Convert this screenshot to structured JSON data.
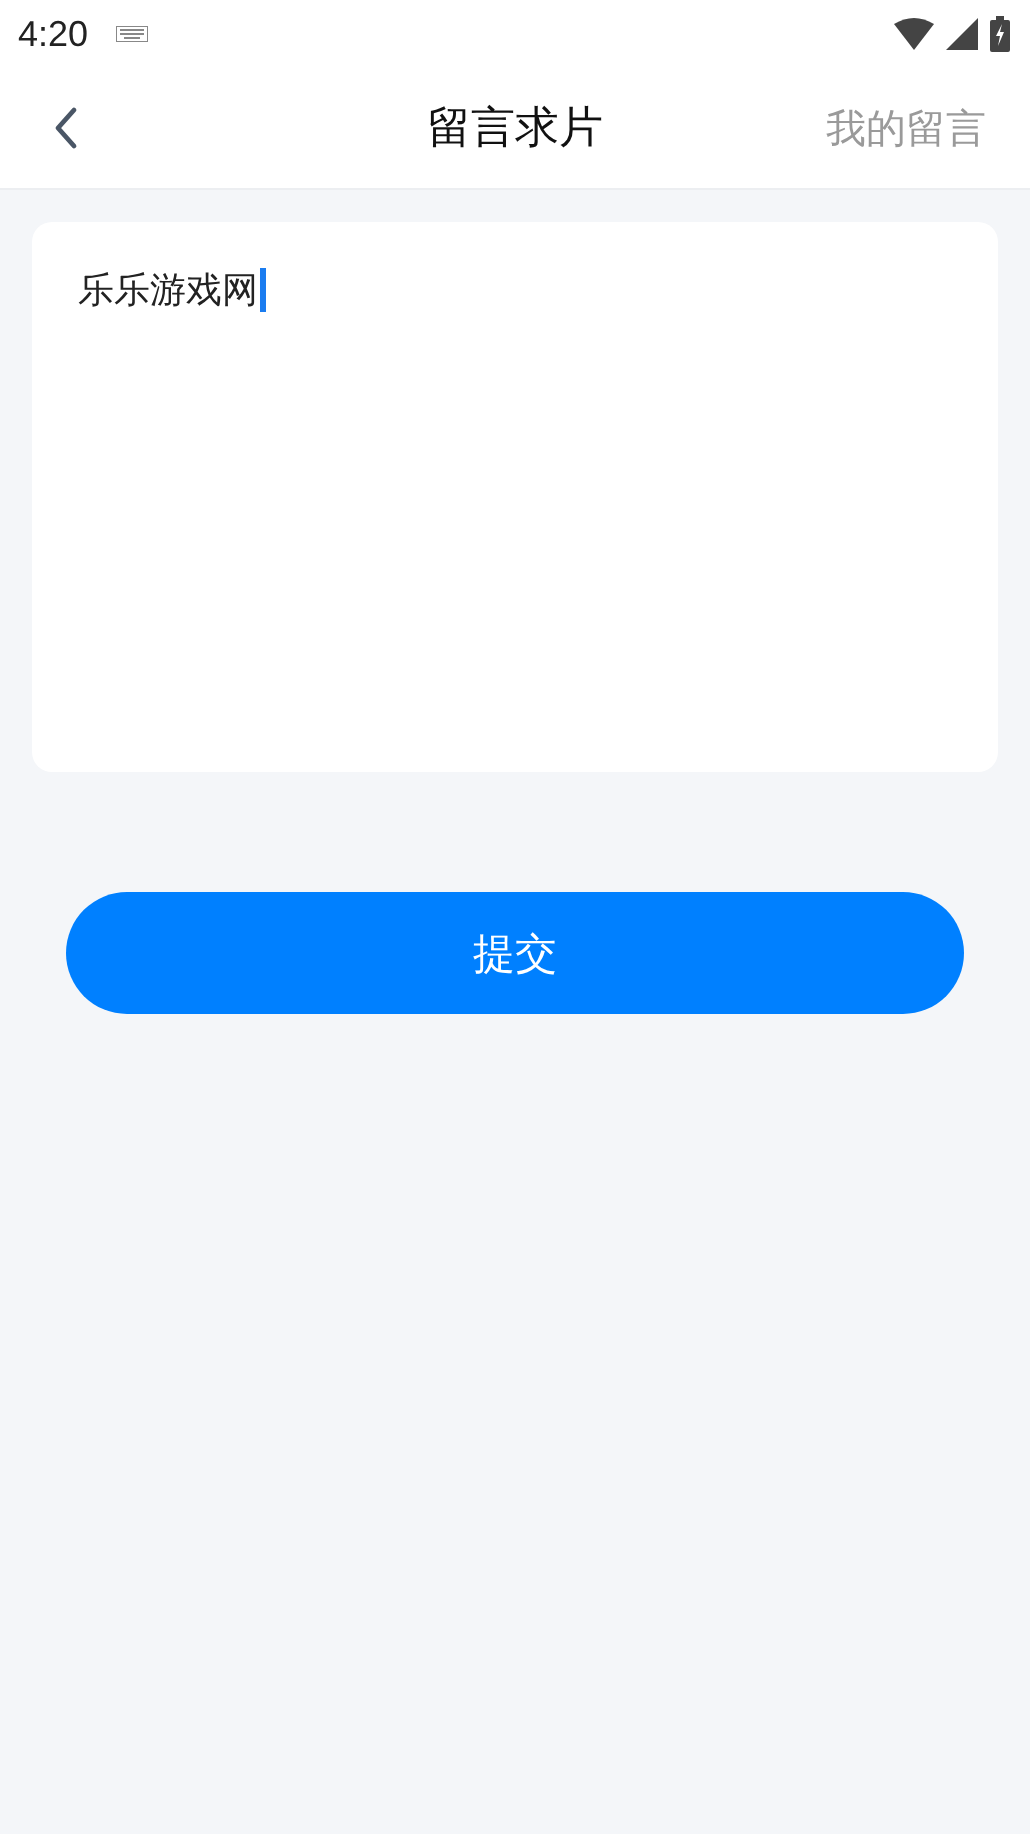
{
  "status_bar": {
    "time": "4:20"
  },
  "header": {
    "title": "留言求片",
    "action": "我的留言"
  },
  "message_field": {
    "value": "乐乐游戏网",
    "focused": true
  },
  "submit_button": {
    "label": "提交"
  }
}
